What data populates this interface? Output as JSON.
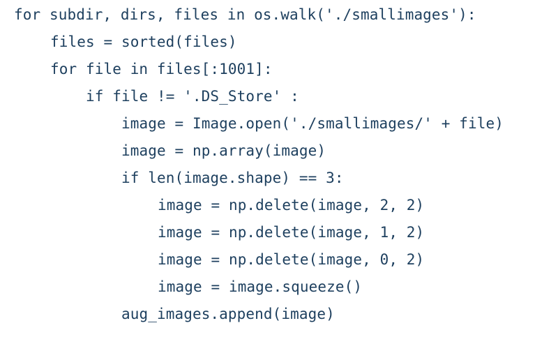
{
  "code": {
    "lines": [
      {
        "indent": 0,
        "text": "for subdir, dirs, files in os.walk('./smallimages'):"
      },
      {
        "indent": 1,
        "text": "files = sorted(files)"
      },
      {
        "indent": 1,
        "text": "for file in files[:1001]:"
      },
      {
        "indent": 2,
        "text": "if file != '.DS_Store' :"
      },
      {
        "indent": 3,
        "text": "image = Image.open('./smallimages/' + file)"
      },
      {
        "indent": 3,
        "text": "image = np.array(image)"
      },
      {
        "indent": 3,
        "text": "if len(image.shape) == 3:"
      },
      {
        "indent": 4,
        "text": "image = np.delete(image, 2, 2)"
      },
      {
        "indent": 4,
        "text": "image = np.delete(image, 1, 2)"
      },
      {
        "indent": 4,
        "text": "image = np.delete(image, 0, 2)"
      },
      {
        "indent": 4,
        "text": "image = image.squeeze()"
      },
      {
        "indent": 3,
        "text": "aug_images.append(image)"
      }
    ]
  }
}
